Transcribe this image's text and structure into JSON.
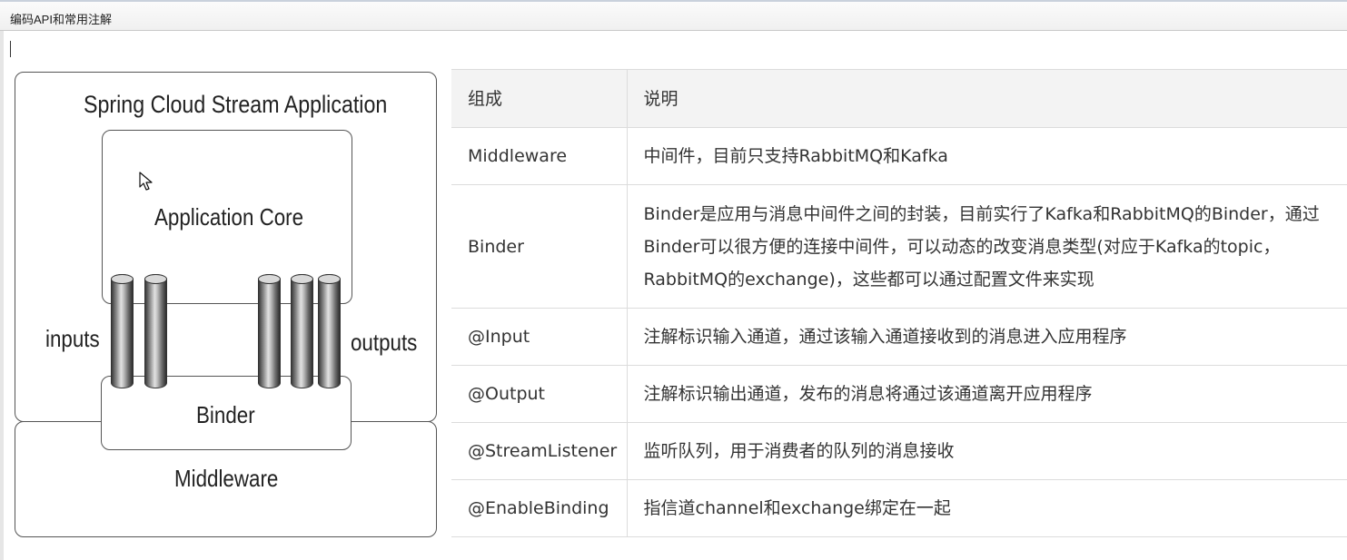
{
  "window": {
    "title": "编码API和常用注解"
  },
  "diagram": {
    "application_label": "Spring Cloud Stream Application",
    "core_label": "Application Core",
    "inputs_label": "inputs",
    "outputs_label": "outputs",
    "binder_label": "Binder",
    "middleware_label": "Middleware"
  },
  "table": {
    "headers": [
      "组成",
      "说明"
    ],
    "rows": [
      {
        "component": "Middleware",
        "description": "中间件，目前只支持RabbitMQ和Kafka"
      },
      {
        "component": "Binder",
        "description_lines": [
          "Binder是应用与消息中间件之间的封装，目前实行了Kafka和RabbitMQ的Binder，通过",
          "Binder可以很方便的连接中间件，可以动态的改变消息类型(对应于Kafka的topic，",
          "RabbitMQ的exchange)，这些都可以通过配置文件来实现"
        ]
      },
      {
        "component": "@Input",
        "description": "注解标识输入通道，通过该输入通道接收到的消息进入应用程序"
      },
      {
        "component": "@Output",
        "description": "注解标识输出通道，发布的消息将通过该通道离开应用程序"
      },
      {
        "component": "@StreamListener",
        "description": "监听队列，用于消费者的队列的消息接收"
      },
      {
        "component": "@EnableBinding",
        "description": "指信道channel和exchange绑定在一起"
      }
    ]
  }
}
